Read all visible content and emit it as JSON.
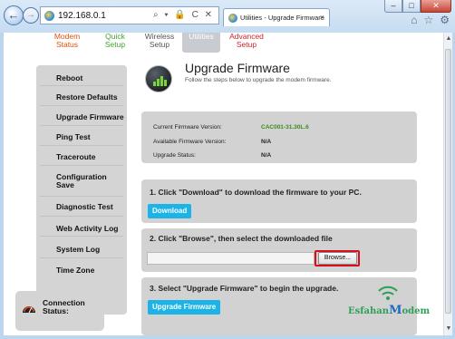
{
  "browser": {
    "url": "192.168.0.1",
    "address_tools": "⌕ ▾ 🔒 C ✕",
    "tab_title": "Utilities - Upgrade Firmware",
    "tab_close": "×",
    "window_buttons": {
      "minimize": "–",
      "maximize": "□",
      "close": "✕"
    },
    "right_icons": [
      "home-icon",
      "star-icon",
      "gear-icon"
    ]
  },
  "topnav": {
    "items": [
      {
        "label": "Modem Status",
        "line1": "Modem",
        "line2": "Status",
        "color": "#e2500a"
      },
      {
        "label": "Quick Setup",
        "line1": "Quick",
        "line2": "Setup",
        "color": "#3fa42b"
      },
      {
        "label": "Wireless Setup",
        "line1": "Wireless",
        "line2": "Setup",
        "color": "#555555"
      },
      {
        "label": "Utilities",
        "line1": "Utilities",
        "line2": "",
        "color": "#ffffff",
        "active": true
      },
      {
        "label": "Advanced Setup",
        "line1": "Advanced",
        "line2": "Setup",
        "color": "#d0252a"
      }
    ]
  },
  "sidebar": {
    "items": [
      {
        "label": "Reboot"
      },
      {
        "label": "Restore Defaults"
      },
      {
        "label": "Upgrade Firmware",
        "active": true
      },
      {
        "label": "Ping Test"
      },
      {
        "label": "Traceroute"
      },
      {
        "line1": "Configuration",
        "line2": "Save"
      },
      {
        "label": "Diagnostic Test"
      },
      {
        "label": "Web Activity Log"
      },
      {
        "label": "System Log"
      },
      {
        "label": "Time Zone"
      }
    ],
    "connection": {
      "line1": "Connection",
      "line2": "Status:"
    }
  },
  "page": {
    "title": "Upgrade Firmware",
    "subtitle": "Follow the steps below to upgrade the modem firmware."
  },
  "firmware_info": {
    "current_label": "Current Firmware Version:",
    "current_value": "CAC001-31.30L.6",
    "available_label": "Available Firmware Version:",
    "available_value": "N/A",
    "status_label": "Upgrade Status:",
    "status_value": "N/A"
  },
  "steps": {
    "step1_text": "1. Click \"Download\" to download the firmware to your PC.",
    "download_label": "Download",
    "step2_text": "2. Click \"Browse\", then select the downloaded file",
    "browse_label": "Browse...",
    "file_value": "",
    "step3_text": "3. Select \"Upgrade Firmware\" to begin the upgrade.",
    "upgrade_label": "Upgrade Firmware"
  },
  "logo": {
    "prefix": "Esfahan",
    "m": "M",
    "suffix": "odem"
  },
  "colors": {
    "accent_blue": "#1cb3e7",
    "highlight_red": "#d70f1b",
    "version_green": "#3a8e17"
  }
}
